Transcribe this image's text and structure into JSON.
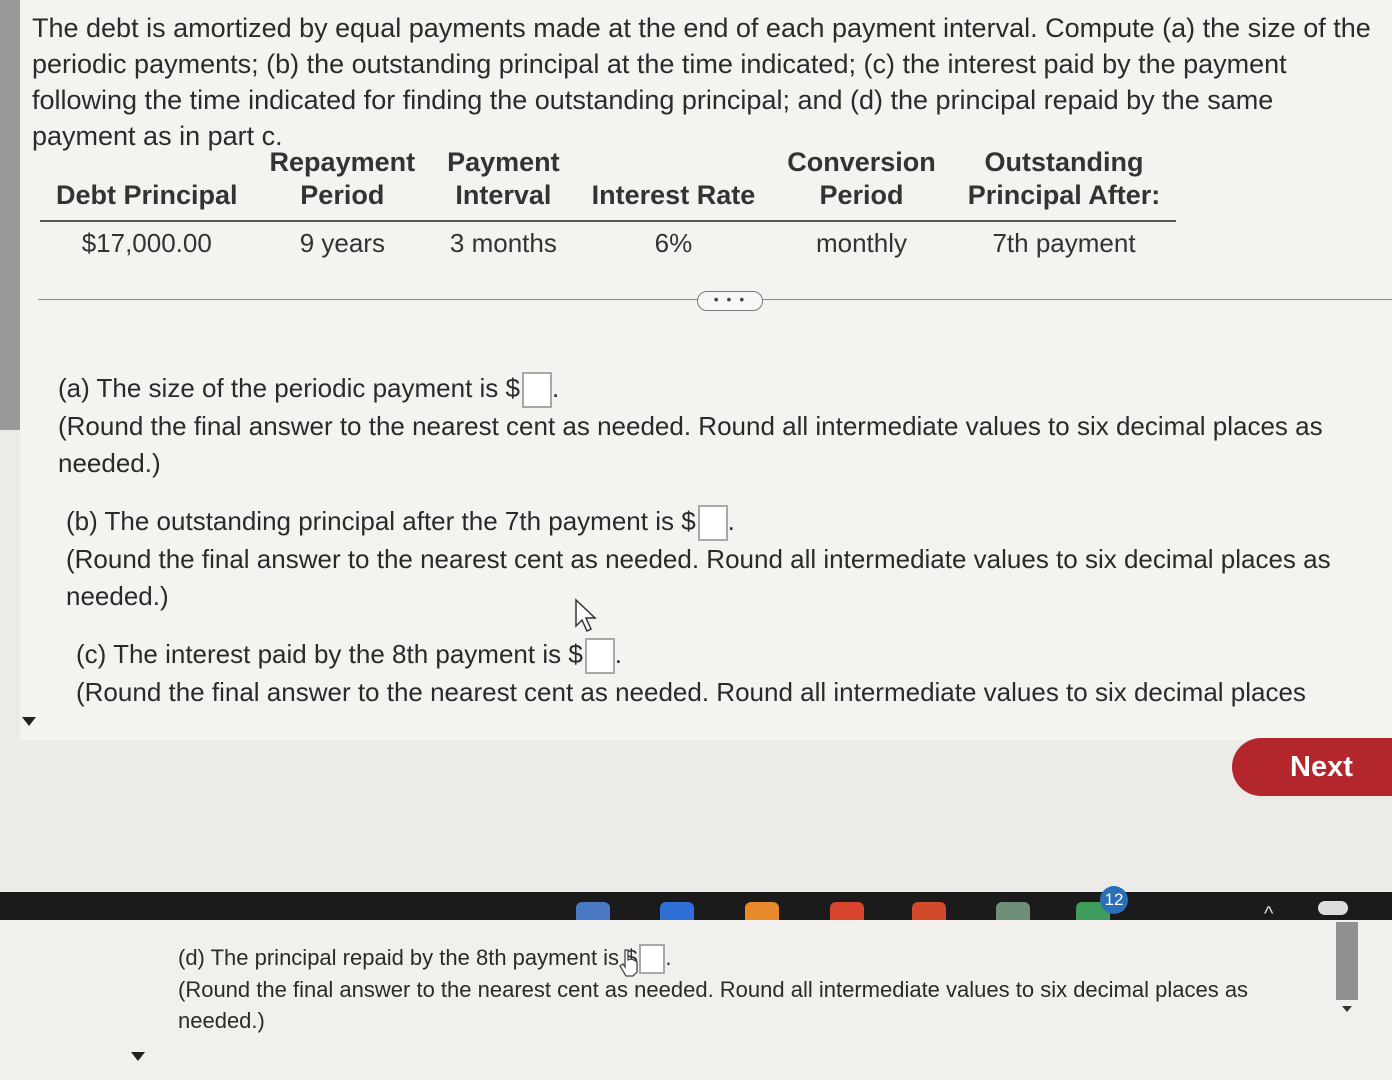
{
  "problem": {
    "intro": "The debt is amortized by equal payments made at the end of each payment interval. Compute (a) the size of the periodic payments; (b) the outstanding principal at the time indicated; (c) the interest paid by the payment following the time indicated for finding the outstanding principal; and (d) the principal repaid by the same payment as in part c."
  },
  "table": {
    "headers": {
      "debt_principal": "Debt Principal",
      "repayment_period_1": "Repayment",
      "repayment_period_2": "Period",
      "payment_interval_1": "Payment",
      "payment_interval_2": "Interval",
      "interest_rate": "Interest Rate",
      "conversion_period_1": "Conversion",
      "conversion_period_2": "Period",
      "outstanding_1": "Outstanding",
      "outstanding_2": "Principal After:"
    },
    "row": {
      "debt_principal": "$17,000.00",
      "repayment_period": "9 years",
      "payment_interval": "3 months",
      "interest_rate": "6%",
      "conversion_period": "monthly",
      "outstanding_after": "7th payment"
    }
  },
  "more_button": "• • •",
  "questions": {
    "a": {
      "text": "(a) The size of the periodic payment is $",
      "end": ".",
      "note": "(Round the final answer to the nearest cent as needed. Round all intermediate values to six decimal places as needed.)"
    },
    "b": {
      "text": "(b) The outstanding principal after the 7th payment is $",
      "end": ".",
      "note": "(Round the final answer to the nearest cent as needed. Round all intermediate values to six decimal places as needed.)"
    },
    "c": {
      "text": "(c) The interest paid by the 8th payment is $",
      "end": ".",
      "note": "(Round the final answer to the nearest cent as needed. Round all intermediate values to six decimal places"
    },
    "d": {
      "text": "(d) The principal repaid by the 8th payment is $",
      "end": ".",
      "note": "(Round the final answer to the nearest cent as needed. Round all intermediate values to six decimal places as needed.)"
    }
  },
  "next_button": "Next",
  "taskbar": {
    "badge_count": "12",
    "tray_chevron": "^"
  },
  "colors": {
    "next_button": "#b3262c",
    "taskbar": "#1b1b1b",
    "badge": "#2a6fb8"
  }
}
